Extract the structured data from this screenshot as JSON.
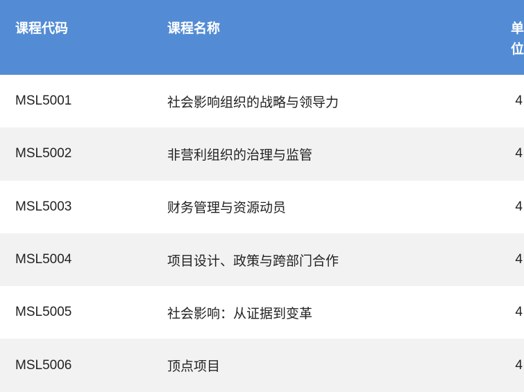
{
  "table": {
    "headers": {
      "code": "课程代码",
      "name": "课程名称",
      "credit": "单位"
    },
    "rows": [
      {
        "code": "MSL5001",
        "name": "社会影响组织的战略与领导力",
        "credit": "4"
      },
      {
        "code": "MSL5002",
        "name": "非营利组织的治理与监管",
        "credit": "4"
      },
      {
        "code": "MSL5003",
        "name": "财务管理与资源动员",
        "credit": "4"
      },
      {
        "code": "MSL5004",
        "name": "项目设计、政策与跨部门合作",
        "credit": "4"
      },
      {
        "code": "MSL5005",
        "name": "社会影响：从证据到变革",
        "credit": "4"
      },
      {
        "code": "MSL5006",
        "name": "顶点项目",
        "credit": "4"
      }
    ]
  },
  "colors": {
    "header_bg": "#538cd4",
    "header_text": "#ffffff",
    "row_alt_bg": "#f2f2f2"
  }
}
